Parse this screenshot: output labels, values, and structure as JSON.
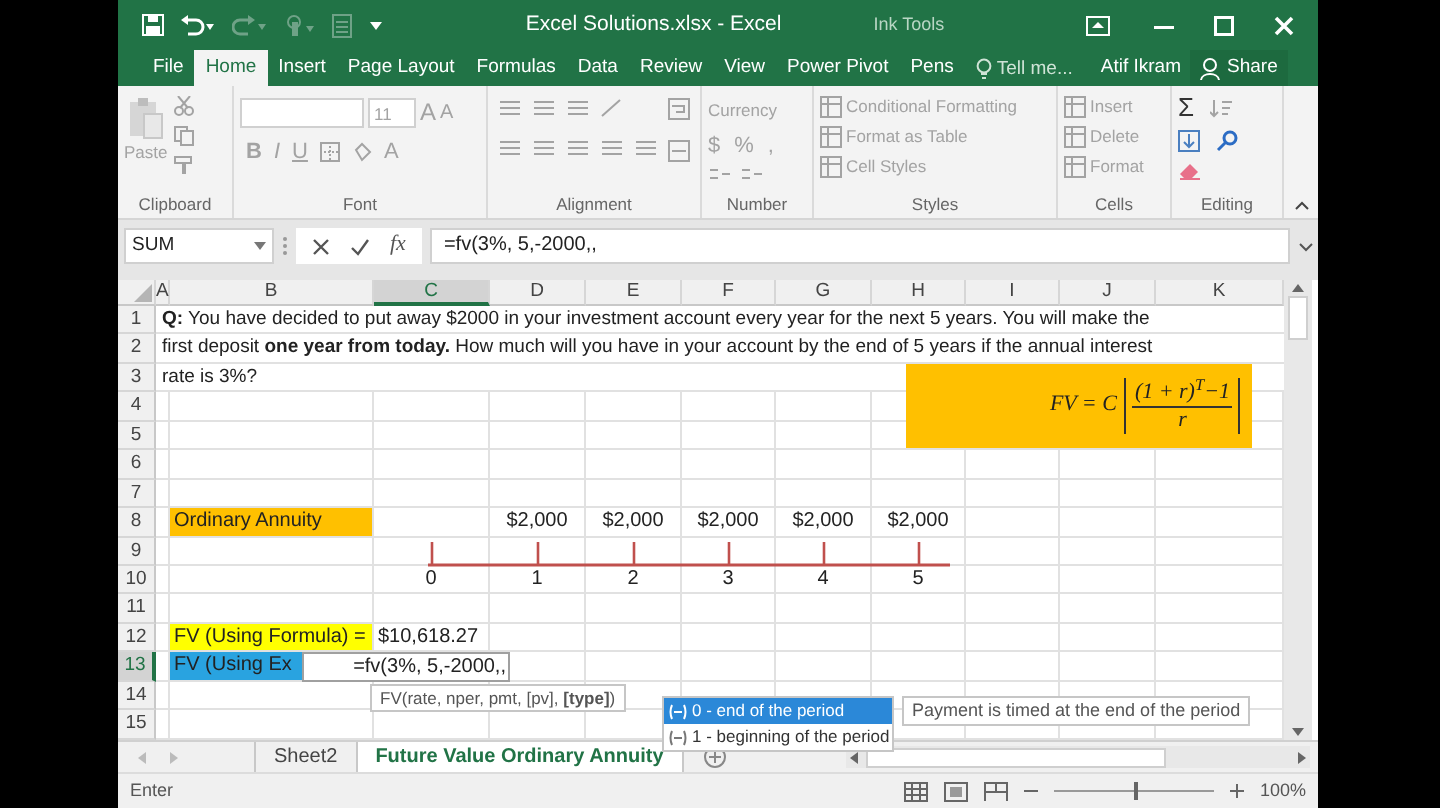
{
  "title_bar": {
    "title": "Excel Solutions.xlsx - Excel",
    "context_label": "Ink Tools"
  },
  "tabs": [
    {
      "label": "File",
      "selected": false
    },
    {
      "label": "Home",
      "selected": true
    },
    {
      "label": "Insert",
      "selected": false
    },
    {
      "label": "Page Layout",
      "selected": false
    },
    {
      "label": "Formulas",
      "selected": false
    },
    {
      "label": "Data",
      "selected": false
    },
    {
      "label": "Review",
      "selected": false
    },
    {
      "label": "View",
      "selected": false
    },
    {
      "label": "Power Pivot",
      "selected": false
    },
    {
      "label": "Pens",
      "selected": false
    }
  ],
  "tell_me": {
    "placeholder": "Tell me..."
  },
  "user": "Atif Ikram",
  "share": "Share",
  "ribbon": {
    "disabled": true,
    "groups": [
      {
        "kind": "clipboard",
        "label": "Clipboard",
        "paste": "Paste"
      },
      {
        "kind": "font",
        "label": "Font",
        "size": "11",
        "grow": "A",
        "shrink": "A",
        "styles": [
          "B",
          "I",
          "U"
        ],
        "font_color": "A"
      },
      {
        "kind": "alignment",
        "label": "Alignment"
      },
      {
        "kind": "number",
        "label": "Number",
        "format": "Currency",
        "symbols": [
          "$",
          "%",
          ","
        ]
      },
      {
        "kind": "styles",
        "label": "Styles",
        "items": [
          "Conditional Formatting",
          "Format as Table",
          "Cell Styles"
        ]
      },
      {
        "kind": "cells",
        "label": "Cells",
        "items": [
          "Insert",
          "Delete",
          "Format"
        ]
      },
      {
        "kind": "editing",
        "label": "Editing",
        "sum": "Σ"
      }
    ]
  },
  "formula_bar": {
    "name_box": "SUM",
    "function_label": "fx",
    "formula": "=fv(3%, 5,-2000,,"
  },
  "columns": [
    {
      "label": "A",
      "selected": false
    },
    {
      "label": "B",
      "selected": false
    },
    {
      "label": "C",
      "selected": true
    },
    {
      "label": "D",
      "selected": false
    },
    {
      "label": "E",
      "selected": false
    },
    {
      "label": "F",
      "selected": false
    },
    {
      "label": "G",
      "selected": false
    },
    {
      "label": "H",
      "selected": false
    },
    {
      "label": "I",
      "selected": false
    },
    {
      "label": "J",
      "selected": false
    },
    {
      "label": "K",
      "selected": false
    }
  ],
  "rows": [
    {
      "label": "1",
      "selected": false
    },
    {
      "label": "2",
      "selected": false
    },
    {
      "label": "3",
      "selected": false
    },
    {
      "label": "4",
      "selected": false
    },
    {
      "label": "5",
      "selected": false
    },
    {
      "label": "6",
      "selected": false
    },
    {
      "label": "7",
      "selected": false
    },
    {
      "label": "8",
      "selected": false
    },
    {
      "label": "9",
      "selected": false
    },
    {
      "label": "10",
      "selected": false
    },
    {
      "label": "11",
      "selected": false
    },
    {
      "label": "12",
      "selected": false
    },
    {
      "label": "13",
      "selected": true
    },
    {
      "label": "14",
      "selected": false
    },
    {
      "label": "15",
      "selected": false
    }
  ],
  "question": [
    "**Q:** You have decided to put away $2000 in your investment account every year for the next 5 years. You will make the",
    "first deposit **one year from today.** How much will you have in your account by the end of 5 years if the annual interest",
    "rate is 3%?"
  ],
  "formula_image": {
    "lhs": "FV = C",
    "numerator": "(1 + r)$^{T}$−1",
    "denominator": "r"
  },
  "annuity": {
    "label": "Ordinary Annuity",
    "payments": [
      "$2,000",
      "$2,000",
      "$2,000",
      "$2,000",
      "$2,000"
    ]
  },
  "timeline": {
    "periods": [
      "0",
      "1",
      "2",
      "3",
      "4",
      "5"
    ]
  },
  "result": {
    "label": "FV (Using Formula) =",
    "value": "$10,618.27"
  },
  "editing": {
    "label": "FV (Using Ex",
    "entry": "=fv(3%, 5,-2000,,"
  },
  "syntax_tooltip": "FV(rate, nper, pmt, [pv], **[type]**)",
  "autocomplete": [
    {
      "label": "0 - end of the period",
      "selected": true
    },
    {
      "label": "1 - beginning of the period",
      "selected": false
    }
  ],
  "hint": "Payment is timed at the end of the period",
  "sheet_tabs": [
    {
      "label": "Sheet2",
      "selected": false
    },
    {
      "label": "Future Value Ordinary Annuity",
      "selected": true
    }
  ],
  "status_bar": {
    "mode": "Enter",
    "zoom": {
      "label": "100%",
      "level": 0.5
    }
  }
}
